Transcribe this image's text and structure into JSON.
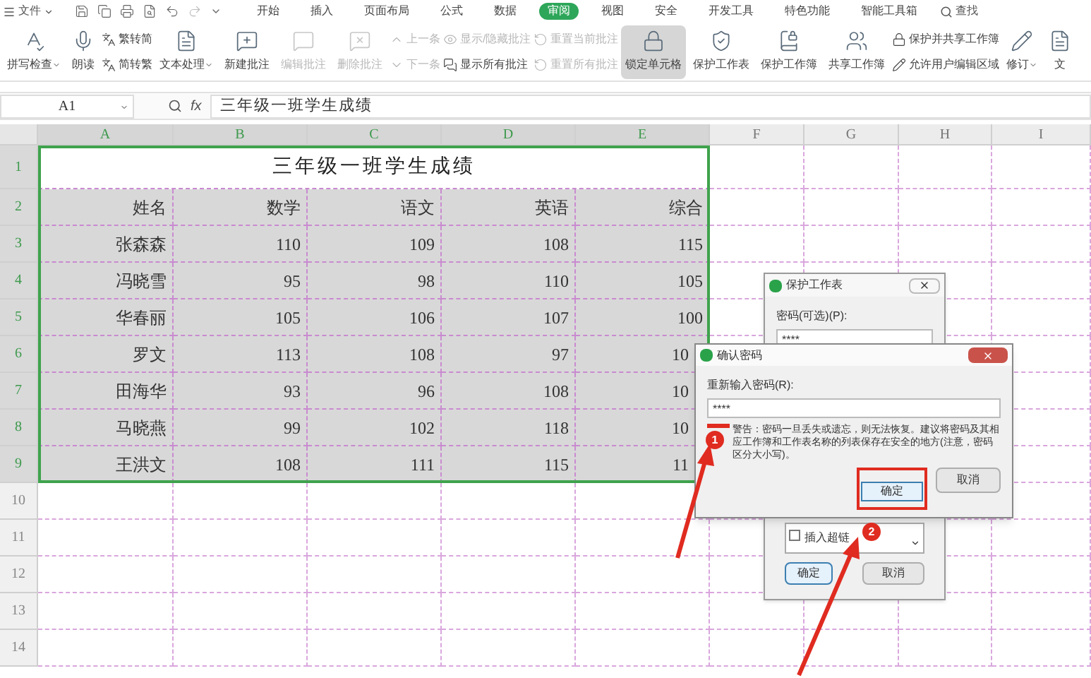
{
  "menu_bar": {
    "file_menu": "文件",
    "tabs": [
      {
        "label": "开始",
        "selected": false
      },
      {
        "label": "插入",
        "selected": false
      },
      {
        "label": "页面布局",
        "selected": false
      },
      {
        "label": "公式",
        "selected": false
      },
      {
        "label": "数据",
        "selected": false
      },
      {
        "label": "审阅",
        "selected": true
      },
      {
        "label": "视图",
        "selected": false
      },
      {
        "label": "安全",
        "selected": false
      },
      {
        "label": "开发工具",
        "selected": false
      },
      {
        "label": "特色功能",
        "selected": false
      },
      {
        "label": "智能工具箱",
        "selected": false
      }
    ],
    "search": "查找"
  },
  "ribbon": [
    {
      "kind": "large",
      "label": "拼写检查",
      "dropdown": true,
      "disabled": false,
      "pressed": false
    },
    {
      "kind": "large",
      "label": "朗读",
      "dropdown": false,
      "disabled": false,
      "pressed": false
    },
    {
      "kind": "stack",
      "items": [
        {
          "label": "繁转简",
          "disabled": false
        },
        {
          "label": "简转繁",
          "disabled": false
        }
      ]
    },
    {
      "kind": "large",
      "label": "文本处理",
      "dropdown": true,
      "disabled": false,
      "pressed": false
    },
    {
      "kind": "large",
      "label": "新建批注",
      "dropdown": false,
      "disabled": false,
      "pressed": false
    },
    {
      "kind": "large",
      "label": "编辑批注",
      "dropdown": false,
      "disabled": true,
      "pressed": false
    },
    {
      "kind": "large",
      "label": "删除批注",
      "dropdown": false,
      "disabled": true,
      "pressed": false
    },
    {
      "kind": "stack",
      "items": [
        {
          "label": "上一条",
          "disabled": true
        },
        {
          "label": "下一条",
          "disabled": true
        }
      ]
    },
    {
      "kind": "stack",
      "items": [
        {
          "label": "显示/隐藏批注",
          "disabled": true
        },
        {
          "label": "显示所有批注",
          "disabled": false
        }
      ]
    },
    {
      "kind": "stack",
      "items": [
        {
          "label": "重置当前批注",
          "disabled": true
        },
        {
          "label": "重置所有批注",
          "disabled": true
        }
      ]
    },
    {
      "kind": "large",
      "label": "锁定单元格",
      "dropdown": false,
      "disabled": false,
      "pressed": true
    },
    {
      "kind": "large",
      "label": "保护工作表",
      "dropdown": false,
      "disabled": false,
      "pressed": false
    },
    {
      "kind": "large",
      "label": "保护工作簿",
      "dropdown": false,
      "disabled": false,
      "pressed": false
    },
    {
      "kind": "large",
      "label": "共享工作簿",
      "dropdown": false,
      "disabled": false,
      "pressed": false
    },
    {
      "kind": "stack",
      "items": [
        {
          "label": "保护并共享工作簿",
          "disabled": false
        },
        {
          "label": "允许用户编辑区域",
          "disabled": false
        }
      ]
    },
    {
      "kind": "large",
      "label": "修订",
      "dropdown": true,
      "disabled": false,
      "pressed": false
    },
    {
      "kind": "large",
      "label": "文",
      "dropdown": false,
      "disabled": false,
      "pressed": false
    }
  ],
  "formula_bar": {
    "name_box": "A1",
    "function_label": "fx",
    "value": "三年级一班学生成绩"
  },
  "sheet": {
    "columns": [
      "A",
      "B",
      "C",
      "D",
      "E",
      "F",
      "G",
      "H",
      "I"
    ],
    "row_numbers": [
      "1",
      "2",
      "3",
      "4",
      "5",
      "6",
      "7",
      "8",
      "9",
      "10",
      "11",
      "12",
      "13",
      "14"
    ],
    "title": "三年级一班学生成绩",
    "header": [
      "姓名",
      "数学",
      "语文",
      "英语",
      "综合"
    ],
    "rows": [
      [
        "张森森",
        "110",
        "109",
        "108",
        "115"
      ],
      [
        "冯晓雪",
        "95",
        "98",
        "110",
        "105"
      ],
      [
        "华春丽",
        "105",
        "106",
        "107",
        "100"
      ],
      [
        "罗文",
        "113",
        "108",
        "97",
        "10"
      ],
      [
        "田海华",
        "93",
        "96",
        "108",
        "10"
      ],
      [
        "马晓燕",
        "99",
        "102",
        "118",
        "10"
      ],
      [
        "王洪文",
        "108",
        "111",
        "115",
        "11"
      ]
    ]
  },
  "protect_sheet_dialog": {
    "title": "保护工作表",
    "password_label": "密码(可选)(P):",
    "password": "****",
    "permission": {
      "label": "插入超链",
      "checked": false
    },
    "ok": "确定",
    "cancel": "取消"
  },
  "confirm_dialog": {
    "title": "确认密码",
    "label": "重新输入密码(R):",
    "password": "****",
    "warning": "警告：密码一旦丢失或遗忘，则无法恢复。建议将密码及其相应工作簿和工作表名称的列表保存在安全的地方(注意，密码区分大小写)。",
    "ok": "确定",
    "cancel": "取消"
  },
  "annotations": [
    {
      "label": "1"
    },
    {
      "label": "2"
    }
  ]
}
